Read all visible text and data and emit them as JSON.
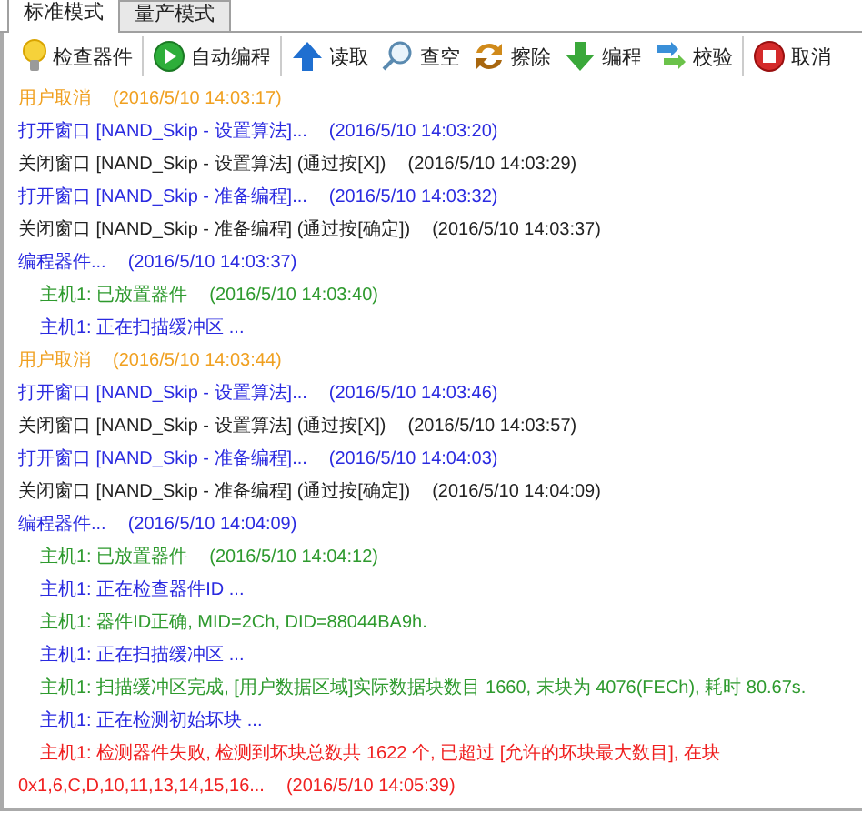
{
  "tabs": [
    {
      "label": "标准模式",
      "selected": true
    },
    {
      "label": "量产模式",
      "selected": false
    }
  ],
  "toolbar": [
    {
      "label": "检查器件",
      "kind": "bulb",
      "separator_before": false
    },
    {
      "label": "自动编程",
      "kind": "play",
      "separator_before": true
    },
    {
      "label": "读取",
      "kind": "up",
      "separator_before": true
    },
    {
      "label": "查空",
      "kind": "search",
      "separator_before": false
    },
    {
      "label": "擦除",
      "kind": "swap",
      "separator_before": false
    },
    {
      "label": "编程",
      "kind": "down",
      "separator_before": false
    },
    {
      "label": "校验",
      "kind": "verify",
      "separator_before": false
    },
    {
      "label": "取消",
      "kind": "stop",
      "separator_before": true
    }
  ],
  "log": [
    {
      "kind": "cancel",
      "text": "用户取消",
      "time": "(2016/5/10 14:03:17)"
    },
    {
      "kind": "open",
      "text": "打开窗口 [NAND_Skip - 设置算法]...",
      "time": "(2016/5/10 14:03:20)"
    },
    {
      "kind": "close",
      "text": "关闭窗口 [NAND_Skip - 设置算法] (通过按[X])",
      "time": "(2016/5/10 14:03:29)"
    },
    {
      "kind": "open",
      "text": "打开窗口 [NAND_Skip - 准备编程]...",
      "time": "(2016/5/10 14:03:32)"
    },
    {
      "kind": "close",
      "text": "关闭窗口 [NAND_Skip - 准备编程] (通过按[确定])",
      "time": "(2016/5/10 14:03:37)"
    },
    {
      "kind": "open",
      "text": "编程器件...",
      "time": "(2016/5/10 14:03:37)",
      "children": [
        {
          "kind": "ok",
          "text": "主机1: 已放置器件",
          "time": "(2016/5/10 14:03:40)"
        },
        {
          "kind": "open",
          "text": "主机1: 正在扫描缓冲区 ..."
        }
      ]
    },
    {
      "kind": "cancel",
      "text": "用户取消",
      "time": "(2016/5/10 14:03:44)"
    },
    {
      "kind": "open",
      "text": "打开窗口 [NAND_Skip - 设置算法]...",
      "time": "(2016/5/10 14:03:46)"
    },
    {
      "kind": "close",
      "text": "关闭窗口 [NAND_Skip - 设置算法] (通过按[X])",
      "time": "(2016/5/10 14:03:57)"
    },
    {
      "kind": "open",
      "text": "打开窗口 [NAND_Skip - 准备编程]...",
      "time": "(2016/5/10 14:04:03)"
    },
    {
      "kind": "close",
      "text": "关闭窗口 [NAND_Skip - 准备编程] (通过按[确定])",
      "time": "(2016/5/10 14:04:09)"
    },
    {
      "kind": "open",
      "text": "编程器件...",
      "time": "(2016/5/10 14:04:09)",
      "children": [
        {
          "kind": "ok",
          "text": "主机1: 已放置器件",
          "time": "(2016/5/10 14:04:12)"
        },
        {
          "kind": "open",
          "text": "主机1: 正在检查器件ID ..."
        },
        {
          "kind": "ok",
          "text": "主机1: 器件ID正确, MID=2Ch, DID=88044BA9h."
        },
        {
          "kind": "open",
          "text": "主机1: 正在扫描缓冲区 ..."
        },
        {
          "kind": "ok",
          "text": "主机1: 扫描缓冲区完成, [用户数据区域]实际数据块数目 1660, 末块为 4076(FECh), 耗时 80.67s."
        },
        {
          "kind": "open",
          "text": "主机1: 正在检测初始坏块 ..."
        },
        {
          "kind": "error",
          "text": "主机1: 检测器件失败, 检测到坏块总数共 1622 个, 已超过 [允许的坏块最大数目], 在块\n0x1,6,C,D,10,11,13,14,15,16...",
          "time": "(2016/5/10 14:05:39)"
        }
      ]
    }
  ]
}
